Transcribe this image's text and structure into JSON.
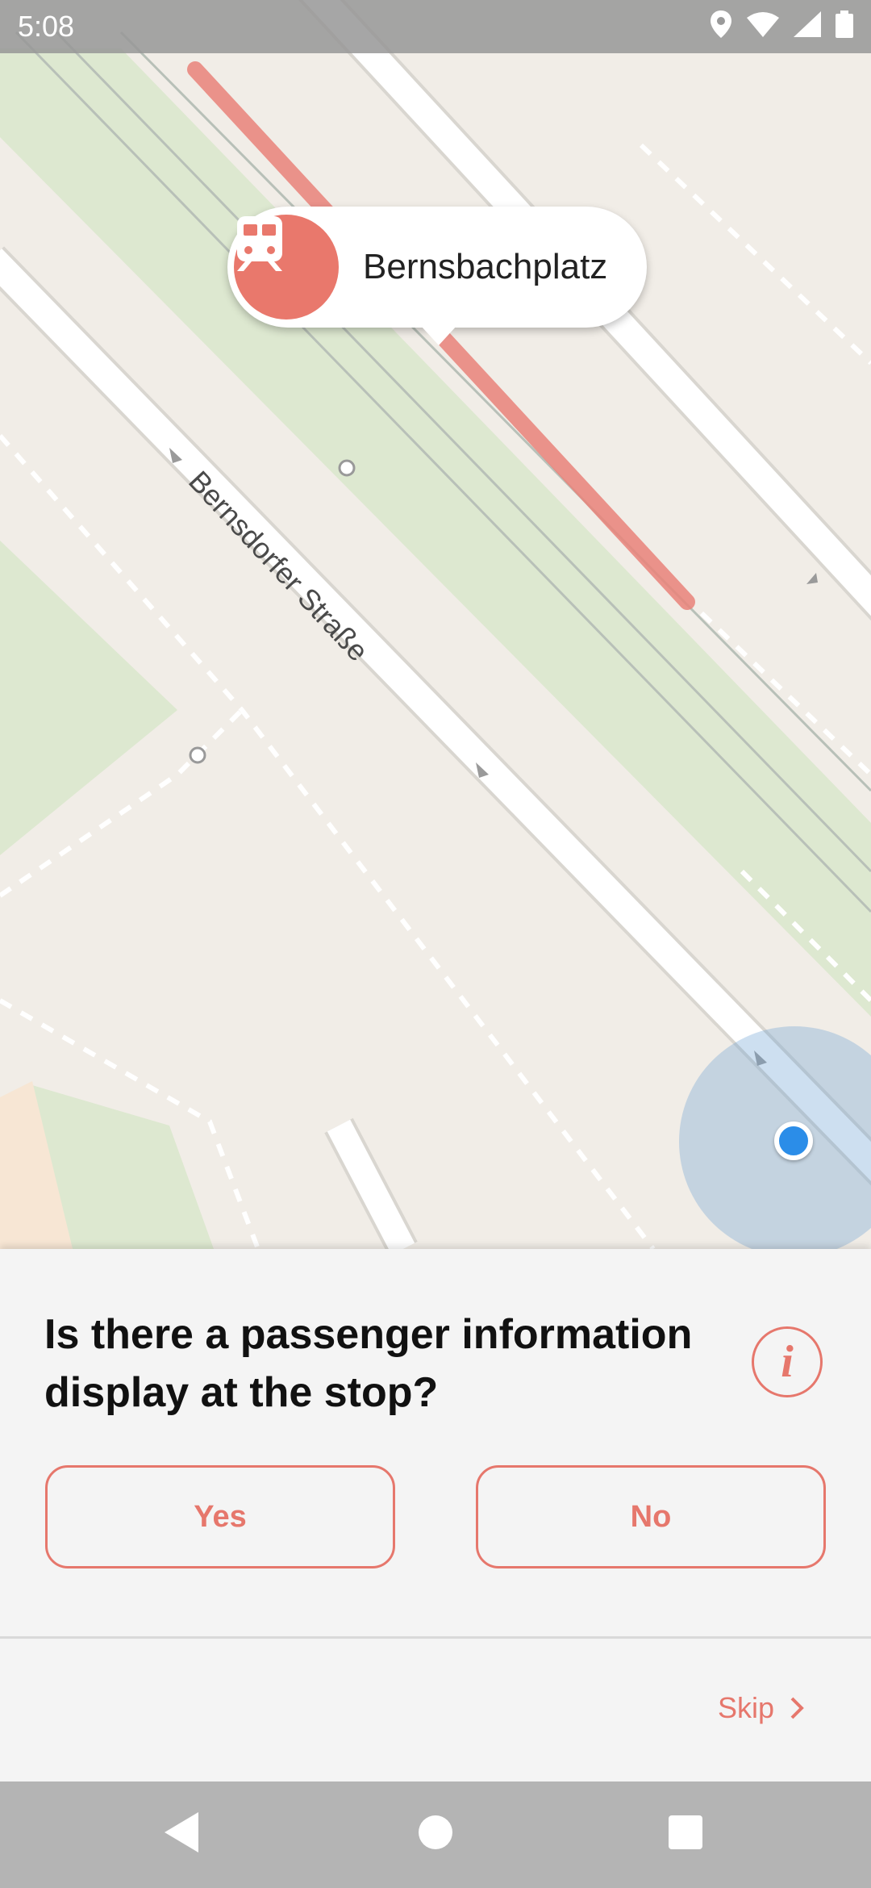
{
  "status_bar": {
    "time": "5:08"
  },
  "map": {
    "street_label": "Bernsdorfer Straße"
  },
  "stop": {
    "name": "Bernsbachplatz"
  },
  "quest": {
    "question": "Is there a passenger information display at the stop?",
    "info_icon": "i",
    "yes_label": "Yes",
    "no_label": "No",
    "skip_label": "Skip"
  },
  "colors": {
    "accent": "#e6776c",
    "location": "#2b8de8"
  }
}
